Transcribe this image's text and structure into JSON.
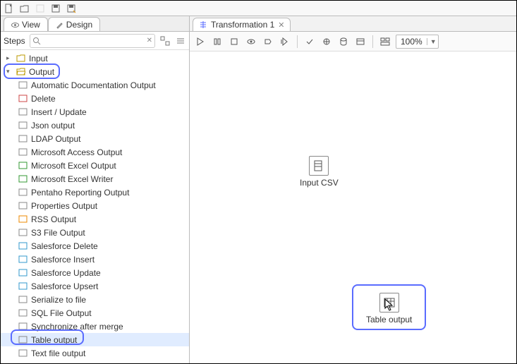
{
  "tabs": {
    "view": "View",
    "design": "Design"
  },
  "steps_header": {
    "label": "Steps"
  },
  "tree": {
    "input": "Input",
    "output": "Output",
    "items": [
      "Automatic Documentation Output",
      "Delete",
      "Insert / Update",
      "Json output",
      "LDAP Output",
      "Microsoft Access Output",
      "Microsoft Excel Output",
      "Microsoft Excel Writer",
      "Pentaho Reporting Output",
      "Properties Output",
      "RSS Output",
      "S3 File Output",
      "Salesforce Delete",
      "Salesforce Insert",
      "Salesforce Update",
      "Salesforce Upsert",
      "Serialize to file",
      "SQL File Output",
      "Synchronize after merge",
      "Table output",
      "Text file output"
    ]
  },
  "editor": {
    "tab_title": "Transformation 1"
  },
  "zoom": {
    "value": "100%"
  },
  "canvas": {
    "node_input": "Input CSV",
    "node_table": "Table output"
  }
}
